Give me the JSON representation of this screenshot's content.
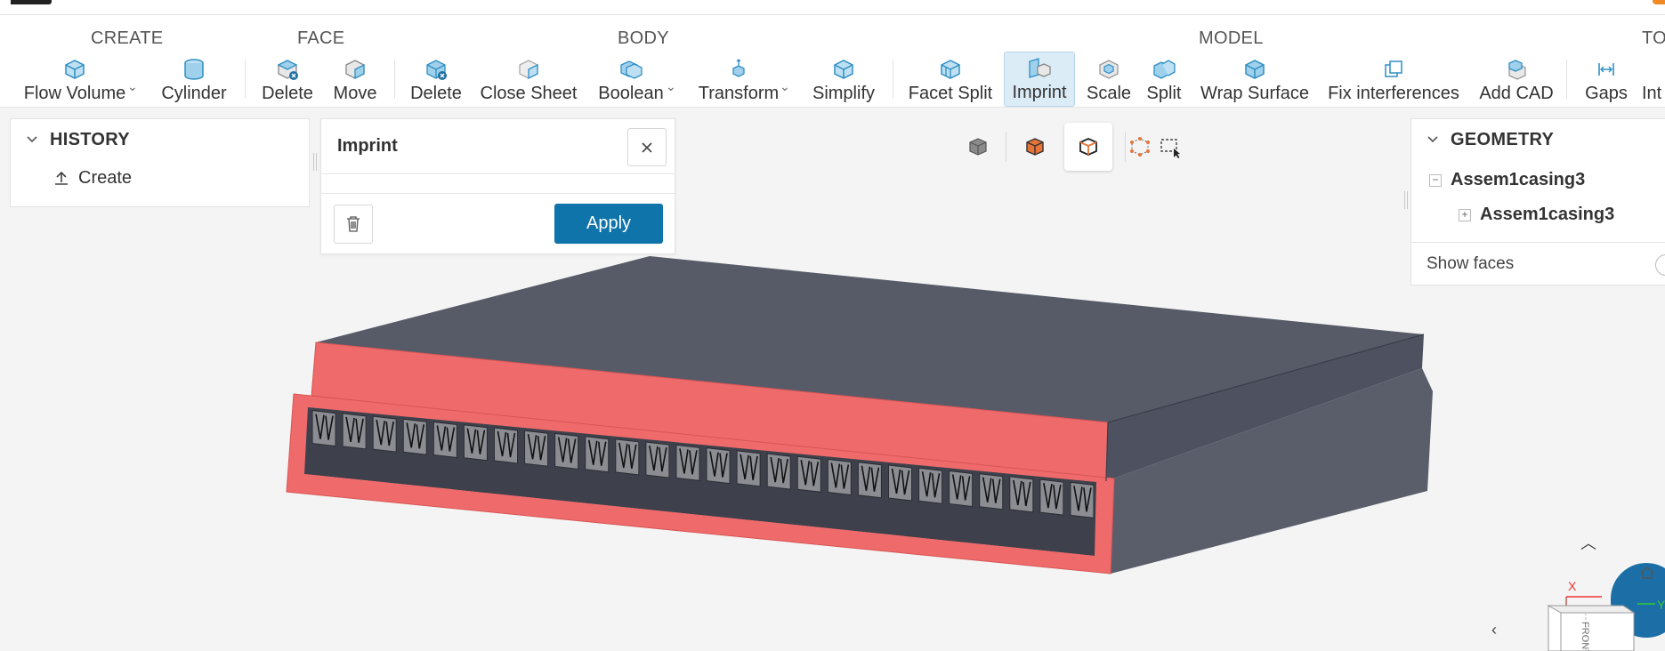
{
  "ribbon": {
    "groups": {
      "create": "CREATE",
      "face": "FACE",
      "body": "BODY",
      "model": "MODEL",
      "tools_partial": "TO"
    },
    "tools": {
      "flow_volume": "Flow Volume",
      "cylinder": "Cylinder",
      "face_delete": "Delete",
      "face_move": "Move",
      "body_delete": "Delete",
      "close_sheet": "Close Sheet",
      "boolean": "Boolean",
      "transform": "Transform",
      "simplify": "Simplify",
      "facet_split": "Facet Split",
      "imprint": "Imprint",
      "scale": "Scale",
      "split": "Split",
      "wrap_surface": "Wrap Surface",
      "fix_interferences": "Fix interferences",
      "add_cad": "Add CAD",
      "gaps": "Gaps",
      "int_partial": "Int"
    },
    "accent": "#4aa3d6"
  },
  "history": {
    "title": "HISTORY",
    "items": [
      {
        "label": "Create",
        "icon": "upload-icon"
      }
    ]
  },
  "dialog": {
    "title": "Imprint",
    "apply_label": "Apply"
  },
  "view_toolbar": {
    "buttons": [
      "solid-cube-icon",
      "orange-faces-cube-icon",
      "orange-edges-cube-icon",
      "vertices-cube-icon",
      "box-select-icon"
    ],
    "active_index": 2
  },
  "geometry": {
    "title": "GEOMETRY",
    "tree": [
      {
        "label": "Assem1casing3",
        "toggle": "−",
        "level": 0
      },
      {
        "label": "Assem1casing3",
        "toggle": "+",
        "level": 1
      }
    ],
    "show_faces_label": "Show faces",
    "show_faces_on": false
  },
  "viewcube": {
    "x_label": "X",
    "y_label": "Y",
    "front_label": "FRONT"
  },
  "colors": {
    "apply_button": "#0e74a9",
    "selected_face": "#ef6b6b",
    "body_dark": "#575b68",
    "body_side": "#4a4e5b"
  }
}
